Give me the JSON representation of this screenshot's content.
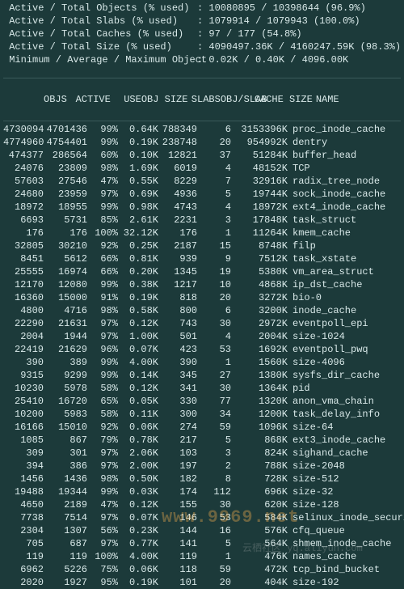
{
  "stats": [
    {
      "label": "Active / Total Objects (% used)",
      "value": "10080895 / 10398644 (96.9%)"
    },
    {
      "label": "Active / Total Slabs (% used)",
      "value": "1079914 / 1079943 (100.0%)"
    },
    {
      "label": "Active / Total Caches (% used)",
      "value": "97 / 177 (54.8%)"
    },
    {
      "label": "Active / Total Size (% used)",
      "value": "4090497.36K / 4160247.59K (98.3%)"
    },
    {
      "label": "Minimum / Average / Maximum Object",
      "value": "0.02K / 0.40K / 4096.00K"
    }
  ],
  "header": {
    "objs": "OBJS",
    "active": "ACTIVE",
    "use": "USE",
    "osize": "OBJ SIZE",
    "slabs": "SLABS",
    "ops": "OBJ/SLAB",
    "csize": "CACHE SIZE",
    "name": "NAME"
  },
  "rows": [
    {
      "objs": "4730094",
      "active": "4701436",
      "use": "99%",
      "osize": "0.64K",
      "slabs": "788349",
      "ops": "6",
      "csize": "3153396K",
      "name": "proc_inode_cache"
    },
    {
      "objs": "4774960",
      "active": "4754401",
      "use": "99%",
      "osize": "0.19K",
      "slabs": "238748",
      "ops": "20",
      "csize": "954992K",
      "name": "dentry"
    },
    {
      "objs": "474377",
      "active": "286564",
      "use": "60%",
      "osize": "0.10K",
      "slabs": "12821",
      "ops": "37",
      "csize": "51284K",
      "name": "buffer_head"
    },
    {
      "objs": "24076",
      "active": "23809",
      "use": "98%",
      "osize": "1.69K",
      "slabs": "6019",
      "ops": "4",
      "csize": "48152K",
      "name": "TCP"
    },
    {
      "objs": "57603",
      "active": "27546",
      "use": "47%",
      "osize": "0.55K",
      "slabs": "8229",
      "ops": "7",
      "csize": "32916K",
      "name": "radix_tree_node"
    },
    {
      "objs": "24680",
      "active": "23959",
      "use": "97%",
      "osize": "0.69K",
      "slabs": "4936",
      "ops": "5",
      "csize": "19744K",
      "name": "sock_inode_cache"
    },
    {
      "objs": "18972",
      "active": "18955",
      "use": "99%",
      "osize": "0.98K",
      "slabs": "4743",
      "ops": "4",
      "csize": "18972K",
      "name": "ext4_inode_cache"
    },
    {
      "objs": "6693",
      "active": "5731",
      "use": "85%",
      "osize": "2.61K",
      "slabs": "2231",
      "ops": "3",
      "csize": "17848K",
      "name": "task_struct"
    },
    {
      "objs": "176",
      "active": "176",
      "use": "100%",
      "osize": "32.12K",
      "slabs": "176",
      "ops": "1",
      "csize": "11264K",
      "name": "kmem_cache"
    },
    {
      "objs": "32805",
      "active": "30210",
      "use": "92%",
      "osize": "0.25K",
      "slabs": "2187",
      "ops": "15",
      "csize": "8748K",
      "name": "filp"
    },
    {
      "objs": "8451",
      "active": "5612",
      "use": "66%",
      "osize": "0.81K",
      "slabs": "939",
      "ops": "9",
      "csize": "7512K",
      "name": "task_xstate"
    },
    {
      "objs": "25555",
      "active": "16974",
      "use": "66%",
      "osize": "0.20K",
      "slabs": "1345",
      "ops": "19",
      "csize": "5380K",
      "name": "vm_area_struct"
    },
    {
      "objs": "12170",
      "active": "12080",
      "use": "99%",
      "osize": "0.38K",
      "slabs": "1217",
      "ops": "10",
      "csize": "4868K",
      "name": "ip_dst_cache"
    },
    {
      "objs": "16360",
      "active": "15000",
      "use": "91%",
      "osize": "0.19K",
      "slabs": "818",
      "ops": "20",
      "csize": "3272K",
      "name": "bio-0"
    },
    {
      "objs": "4800",
      "active": "4716",
      "use": "98%",
      "osize": "0.58K",
      "slabs": "800",
      "ops": "6",
      "csize": "3200K",
      "name": "inode_cache"
    },
    {
      "objs": "22290",
      "active": "21631",
      "use": "97%",
      "osize": "0.12K",
      "slabs": "743",
      "ops": "30",
      "csize": "2972K",
      "name": "eventpoll_epi"
    },
    {
      "objs": "2004",
      "active": "1944",
      "use": "97%",
      "osize": "1.00K",
      "slabs": "501",
      "ops": "4",
      "csize": "2004K",
      "name": "size-1024"
    },
    {
      "objs": "22419",
      "active": "21629",
      "use": "96%",
      "osize": "0.07K",
      "slabs": "423",
      "ops": "53",
      "csize": "1692K",
      "name": "eventpoll_pwq"
    },
    {
      "objs": "390",
      "active": "389",
      "use": "99%",
      "osize": "4.00K",
      "slabs": "390",
      "ops": "1",
      "csize": "1560K",
      "name": "size-4096"
    },
    {
      "objs": "9315",
      "active": "9299",
      "use": "99%",
      "osize": "0.14K",
      "slabs": "345",
      "ops": "27",
      "csize": "1380K",
      "name": "sysfs_dir_cache"
    },
    {
      "objs": "10230",
      "active": "5978",
      "use": "58%",
      "osize": "0.12K",
      "slabs": "341",
      "ops": "30",
      "csize": "1364K",
      "name": "pid"
    },
    {
      "objs": "25410",
      "active": "16720",
      "use": "65%",
      "osize": "0.05K",
      "slabs": "330",
      "ops": "77",
      "csize": "1320K",
      "name": "anon_vma_chain"
    },
    {
      "objs": "10200",
      "active": "5983",
      "use": "58%",
      "osize": "0.11K",
      "slabs": "300",
      "ops": "34",
      "csize": "1200K",
      "name": "task_delay_info"
    },
    {
      "objs": "16166",
      "active": "15010",
      "use": "92%",
      "osize": "0.06K",
      "slabs": "274",
      "ops": "59",
      "csize": "1096K",
      "name": "size-64"
    },
    {
      "objs": "1085",
      "active": "867",
      "use": "79%",
      "osize": "0.78K",
      "slabs": "217",
      "ops": "5",
      "csize": "868K",
      "name": "ext3_inode_cache"
    },
    {
      "objs": "309",
      "active": "301",
      "use": "97%",
      "osize": "2.06K",
      "slabs": "103",
      "ops": "3",
      "csize": "824K",
      "name": "sighand_cache"
    },
    {
      "objs": "394",
      "active": "386",
      "use": "97%",
      "osize": "2.00K",
      "slabs": "197",
      "ops": "2",
      "csize": "788K",
      "name": "size-2048"
    },
    {
      "objs": "1456",
      "active": "1436",
      "use": "98%",
      "osize": "0.50K",
      "slabs": "182",
      "ops": "8",
      "csize": "728K",
      "name": "size-512"
    },
    {
      "objs": "19488",
      "active": "19344",
      "use": "99%",
      "osize": "0.03K",
      "slabs": "174",
      "ops": "112",
      "csize": "696K",
      "name": "size-32"
    },
    {
      "objs": "4650",
      "active": "2189",
      "use": "47%",
      "osize": "0.12K",
      "slabs": "155",
      "ops": "30",
      "csize": "620K",
      "name": "size-128"
    },
    {
      "objs": "7738",
      "active": "7514",
      "use": "97%",
      "osize": "0.07K",
      "slabs": "146",
      "ops": "53",
      "csize": "584K",
      "name": "selinux_inode_security"
    },
    {
      "objs": "2304",
      "active": "1307",
      "use": "56%",
      "osize": "0.23K",
      "slabs": "144",
      "ops": "16",
      "csize": "576K",
      "name": "cfq_queue"
    },
    {
      "objs": "705",
      "active": "687",
      "use": "97%",
      "osize": "0.77K",
      "slabs": "141",
      "ops": "5",
      "csize": "564K",
      "name": "shmem_inode_cache"
    },
    {
      "objs": "119",
      "active": "119",
      "use": "100%",
      "osize": "4.00K",
      "slabs": "119",
      "ops": "1",
      "csize": "476K",
      "name": "names_cache"
    },
    {
      "objs": "6962",
      "active": "5226",
      "use": "75%",
      "osize": "0.06K",
      "slabs": "118",
      "ops": "59",
      "csize": "472K",
      "name": "tcp_bind_bucket"
    },
    {
      "objs": "2020",
      "active": "1927",
      "use": "95%",
      "osize": "0.19K",
      "slabs": "101",
      "ops": "20",
      "csize": "404K",
      "name": "size-192"
    }
  ],
  "watermark": "www.9969.net",
  "watermark2": "云栖社区 yq.aliyun.com"
}
